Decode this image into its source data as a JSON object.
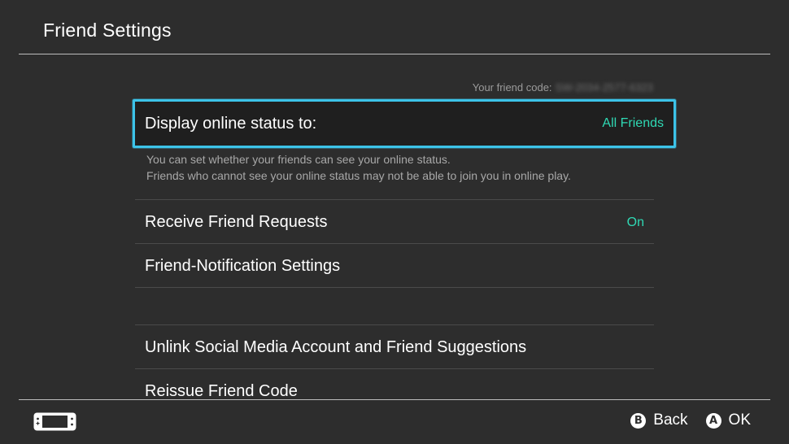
{
  "header": {
    "title": "Friend Settings"
  },
  "friend_code": {
    "label": "Your friend code:",
    "value": "SW-2034-2577-6323"
  },
  "settings": {
    "display_online_status": {
      "label": "Display online status to:",
      "value": "All Friends",
      "description_line1": "You can set whether your friends can see your online status.",
      "description_line2": "Friends who cannot see your online status may not be able to join you in online play."
    },
    "receive_friend_requests": {
      "label": "Receive Friend Requests",
      "value": "On"
    },
    "friend_notification_settings": {
      "label": "Friend-Notification Settings"
    },
    "unlink_social": {
      "label": "Unlink Social Media Account and Friend Suggestions"
    },
    "reissue_friend_code": {
      "label": "Reissue Friend Code"
    }
  },
  "footer": {
    "back_button_glyph": "B",
    "back_label": "Back",
    "ok_button_glyph": "A",
    "ok_label": "OK",
    "console_icon": "handheld-console-icon"
  },
  "colors": {
    "background": "#2d2d2d",
    "accent_value": "#2fd9b4",
    "selection_border": "#3cc3e8",
    "divider": "#4a4a4a"
  }
}
